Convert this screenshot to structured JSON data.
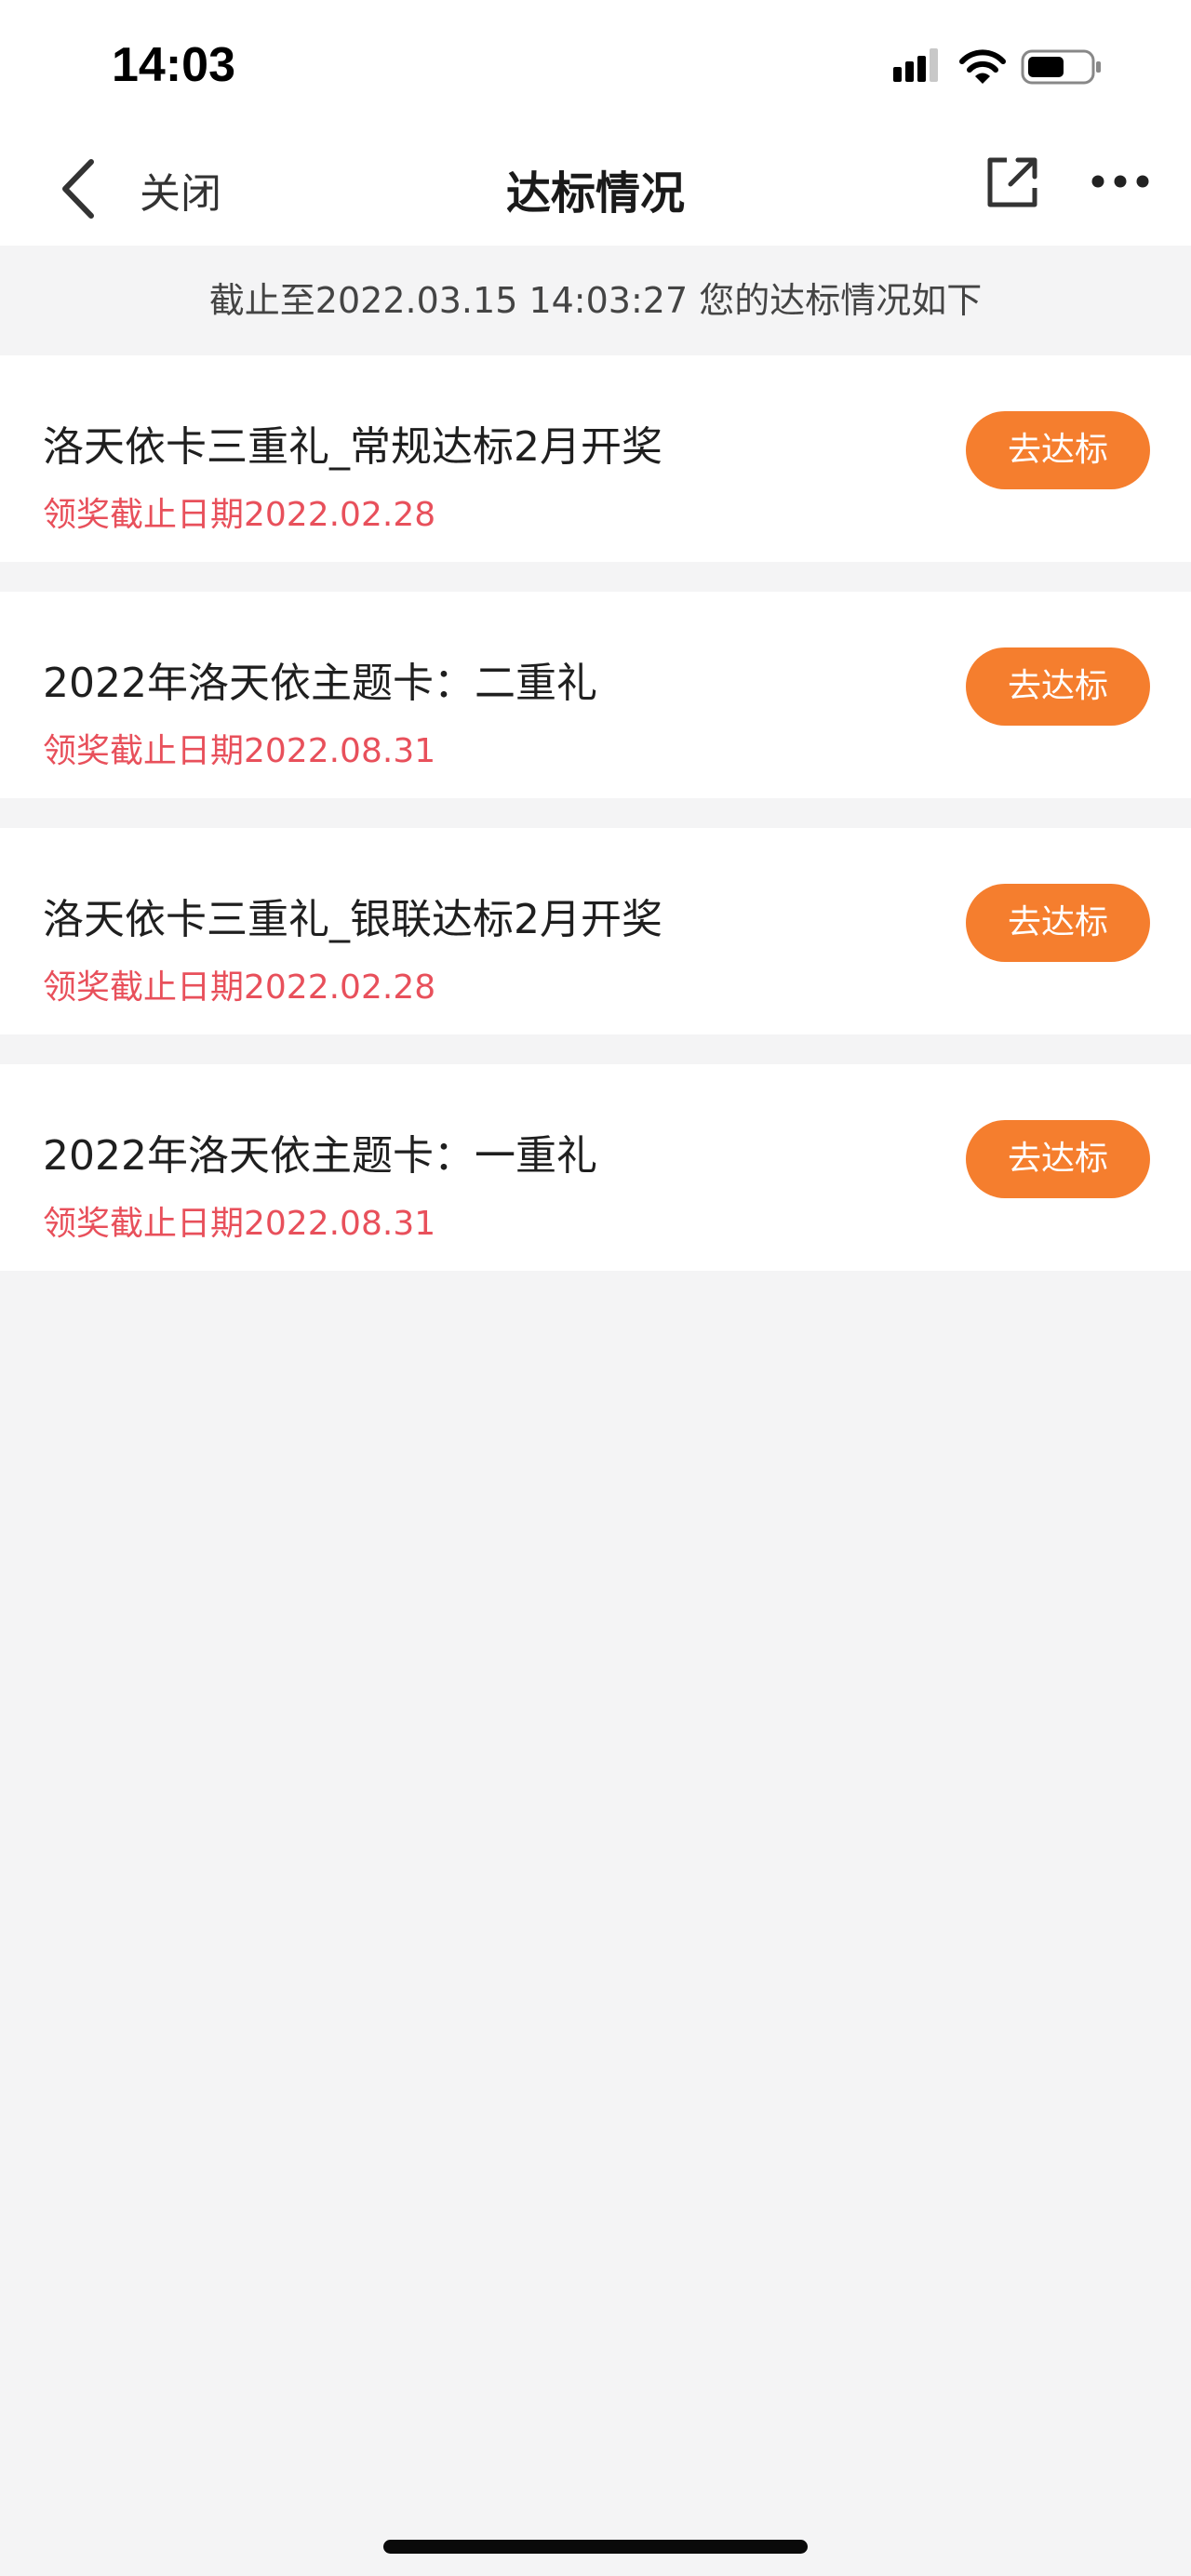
{
  "status_bar": {
    "time": "14:03"
  },
  "nav": {
    "close_label": "关闭",
    "title": "达标情况"
  },
  "notice": "截止至2022.03.15 14:03:27 您的达标情况如下",
  "cards": [
    {
      "title": "洛天依卡三重礼_常规达标2月开奖",
      "deadline": "领奖截止日期2022.02.28",
      "button": "去达标"
    },
    {
      "title": "2022年洛天依主题卡：二重礼",
      "deadline": "领奖截止日期2022.08.31",
      "button": "去达标"
    },
    {
      "title": "洛天依卡三重礼_银联达标2月开奖",
      "deadline": "领奖截止日期2022.02.28",
      "button": "去达标"
    },
    {
      "title": "2022年洛天依主题卡：一重礼",
      "deadline": "领奖截止日期2022.08.31",
      "button": "去达标"
    }
  ],
  "icons": {
    "signal": "cellular-signal-icon",
    "wifi": "wifi-icon",
    "battery": "battery-icon",
    "back": "chevron-left-icon",
    "share": "share-external-icon",
    "more": "more-dots-icon"
  },
  "colors": {
    "accent_button": "#f57e2e",
    "deadline_text": "#e8505b",
    "page_background": "#f4f4f5"
  }
}
